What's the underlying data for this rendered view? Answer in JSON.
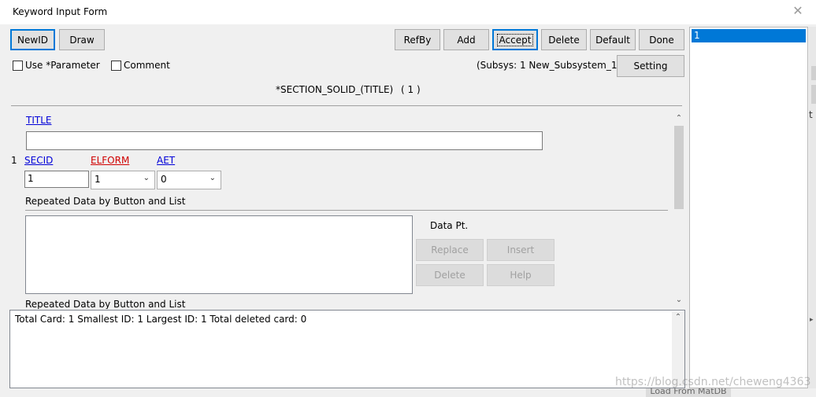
{
  "window": {
    "title": "Keyword Input Form"
  },
  "toolbar_left": [
    {
      "label": "NewID"
    },
    {
      "label": "Draw"
    }
  ],
  "toolbar_right": [
    {
      "label": "RefBy"
    },
    {
      "label": "Add"
    },
    {
      "label": "Accept"
    },
    {
      "label": "Delete"
    },
    {
      "label": "Default"
    },
    {
      "label": "Done"
    }
  ],
  "options": {
    "use_parameter": "Use *Parameter",
    "comment": "Comment",
    "subsys": "(Subsys: 1 New_Subsystem_1)",
    "setting": "Setting"
  },
  "keyword_heading": "*SECTION_SOLID_(TITLE)",
  "keyword_count": "( 1 )",
  "fields": {
    "title_label": "TITLE",
    "title_value": "",
    "row_number": "1",
    "secid_label": "SECID",
    "secid_value": "1",
    "elform_label": "ELFORM",
    "elform_value": "1",
    "aet_label": "AET",
    "aet_value": "0"
  },
  "repeated_section": {
    "title": "Repeated Data by Button and List",
    "data_pt": "Data Pt.",
    "buttons": [
      "Replace",
      "Insert",
      "Delete",
      "Help"
    ],
    "next_title": "Repeated Data by Button and List"
  },
  "summary": {
    "text": "Total Card: 1    Smallest ID: 1    Largest ID: 1    Total deleted card:  0"
  },
  "id_list": [
    "1"
  ],
  "background": {
    "right_letter": "t",
    "bottom_button": "Load From MatDB",
    "watermark": "https://blog.csdn.net/cheweng4363"
  }
}
